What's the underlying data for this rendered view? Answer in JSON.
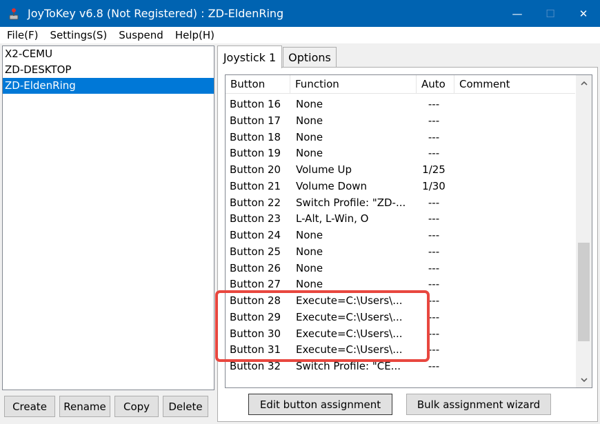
{
  "window": {
    "title": "JoyToKey v6.8 (Not Registered) : ZD-EldenRing",
    "minimize_glyph": "—",
    "maximize_glyph": "☐",
    "close_glyph": "✕"
  },
  "menu": [
    "File(F)",
    "Settings(S)",
    "Suspend",
    "Help(H)"
  ],
  "profiles": [
    {
      "label": "X2-CEMU",
      "selected": false
    },
    {
      "label": "ZD-DESKTOP",
      "selected": false
    },
    {
      "label": "ZD-EldenRing",
      "selected": true
    }
  ],
  "profile_buttons": {
    "create": "Create",
    "rename": "Rename",
    "copy": "Copy",
    "delete": "Delete"
  },
  "tabs": [
    {
      "label": "Joystick 1",
      "active": true
    },
    {
      "label": "Options",
      "active": false
    }
  ],
  "list": {
    "columns": [
      "Button",
      "Function",
      "Auto",
      "Comment"
    ],
    "rows": [
      {
        "button": "Button 16",
        "function": "None",
        "auto": "---",
        "comment": ""
      },
      {
        "button": "Button 17",
        "function": "None",
        "auto": "---",
        "comment": ""
      },
      {
        "button": "Button 18",
        "function": "None",
        "auto": "---",
        "comment": ""
      },
      {
        "button": "Button 19",
        "function": "None",
        "auto": "---",
        "comment": ""
      },
      {
        "button": "Button 20",
        "function": "Volume Up",
        "auto": "1/25",
        "comment": ""
      },
      {
        "button": "Button 21",
        "function": "Volume Down",
        "auto": "1/30",
        "comment": ""
      },
      {
        "button": "Button 22",
        "function": "Switch Profile: \"ZD-...",
        "auto": "---",
        "comment": ""
      },
      {
        "button": "Button 23",
        "function": "L-Alt, L-Win, O",
        "auto": "---",
        "comment": ""
      },
      {
        "button": "Button 24",
        "function": "None",
        "auto": "---",
        "comment": ""
      },
      {
        "button": "Button 25",
        "function": "None",
        "auto": "---",
        "comment": ""
      },
      {
        "button": "Button 26",
        "function": "None",
        "auto": "---",
        "comment": ""
      },
      {
        "button": "Button 27",
        "function": "None",
        "auto": "---",
        "comment": ""
      },
      {
        "button": "Button 28",
        "function": "Execute=C:\\Users\\...",
        "auto": "---",
        "comment": ""
      },
      {
        "button": "Button 29",
        "function": "Execute=C:\\Users\\...",
        "auto": "---",
        "comment": ""
      },
      {
        "button": "Button 30",
        "function": "Execute=C:\\Users\\...",
        "auto": "---",
        "comment": ""
      },
      {
        "button": "Button 31",
        "function": "Execute=C:\\Users\\...",
        "auto": "---",
        "comment": ""
      },
      {
        "button": "Button 32",
        "function": "Switch Profile: \"CE...",
        "auto": "---",
        "comment": ""
      }
    ]
  },
  "scrollbar": {
    "position_fraction": 0.83,
    "visible_fraction": 0.35
  },
  "actions": {
    "edit": "Edit button assignment",
    "bulk": "Bulk assignment wizard"
  },
  "colors": {
    "titlebar": "#0063b1",
    "selection": "#0078d7",
    "highlight": "#e8473f"
  }
}
